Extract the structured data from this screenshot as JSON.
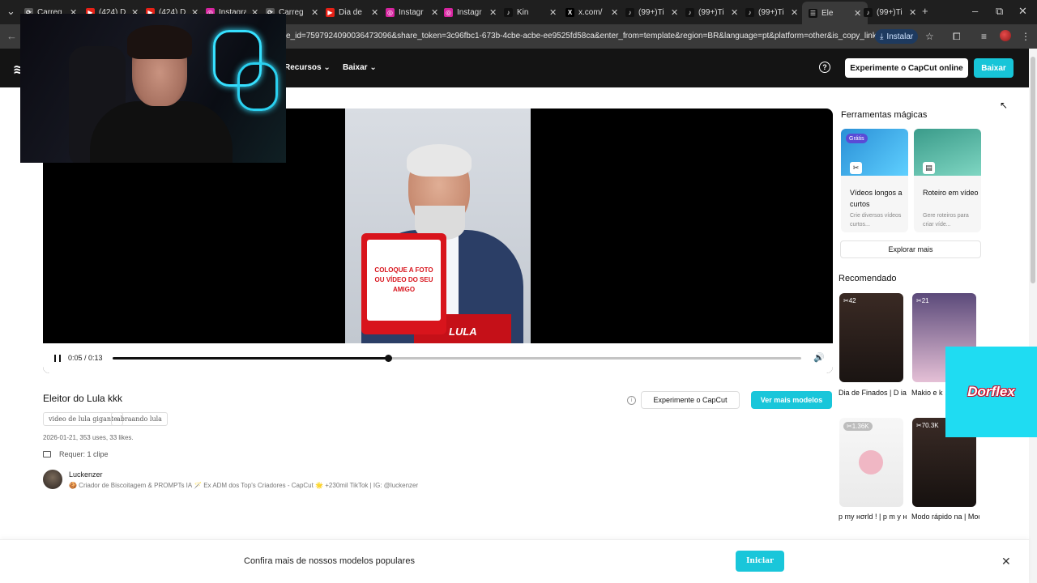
{
  "browser": {
    "tabs": [
      {
        "title": "Carreg",
        "fav": "⟳",
        "color": "#555"
      },
      {
        "title": "(424) D",
        "fav": "▶",
        "color": "#e62117"
      },
      {
        "title": "(424) D",
        "fav": "▶",
        "color": "#e62117"
      },
      {
        "title": "Instagra",
        "fav": "◎",
        "color": "#d6249f"
      },
      {
        "title": "Carreg",
        "fav": "⟳",
        "color": "#555"
      },
      {
        "title": "Dia de",
        "fav": "▶",
        "color": "#e62117"
      },
      {
        "title": "Instagr",
        "fav": "◎",
        "color": "#d6249f"
      },
      {
        "title": "Instagr",
        "fav": "◎",
        "color": "#d6249f"
      },
      {
        "title": "Kin",
        "fav": "♪",
        "color": "#111"
      },
      {
        "title": "x.com/",
        "fav": "X",
        "color": "#000"
      },
      {
        "title": "(99+)Ti",
        "fav": "♪",
        "color": "#111"
      },
      {
        "title": "(99+)Ti",
        "fav": "♪",
        "color": "#111"
      },
      {
        "title": "(99+)Ti",
        "fav": "♪",
        "color": "#111"
      },
      {
        "title": "Ele",
        "fav": "☰",
        "color": "#111"
      },
      {
        "title": "(99+)Ti",
        "fav": "♪",
        "color": "#111"
      }
    ],
    "url": "e_id=7597924090036473096&share_token=3c96fbc1-673b-4cbe-acbe-ee9525fd58ca&enter_from=template&region=BR&language=pt&platform=other&is_copy_link=0",
    "install_label": "Instalar"
  },
  "header": {
    "logo": "≋",
    "menu": [
      "Recursos",
      "Baixar"
    ],
    "try_online": "Experimente o CapCut online",
    "download": "Baixar"
  },
  "player": {
    "poster_text": "COLOQUE A FOTO OU VÍDEO DO SEU AMIGO",
    "poster_brand": "LULA",
    "time": "0:05 / 0:13",
    "progress": 0.4
  },
  "video": {
    "title": "Eleitor do Lula kkk",
    "tags": [
      "video de lula gigante",
      "abraando lula"
    ],
    "stats": "2026-01-21, 353 uses, 33 likes.",
    "requirement": "Requer: 1 clipe",
    "creator": "Luckenzer",
    "creator_bio": "🍪 Criador de Biscoitagem & PROMPTs IA 🪄 Ex ADM dos Top's Criadores - CapCut 🌟 +230mil TikTok | IG: @luckenzer",
    "try_button": "Experimente o CapCut",
    "more_models": "Ver mais modelos"
  },
  "sidebar": {
    "tools_heading": "Ferramentas mágicas",
    "tools": [
      {
        "title": "Vídeos longos a curtos",
        "desc": "Crie diversos vídeos curtos...",
        "badge": "Grátis"
      },
      {
        "title": "Roteiro em vídeo",
        "desc": "Gere roteiros para criar víde..."
      }
    ],
    "explore": "Explorar mais",
    "rec_heading": "Recomendado",
    "recommended": [
      {
        "uses": "42",
        "title": "Dia de Finados | D ia de Finados |#..."
      },
      {
        "uses": "21",
        "title": "Makio e k ✨ | Maki"
      },
      {
        "uses": "1.36K",
        "title": "p my нσrld ! | p m y нσrld ! |🫶"
      },
      {
        "uses": "70.3K",
        "title": "Modo rápido na | Modo rápido na |..."
      }
    ]
  },
  "ad": {
    "brand": "Dorflex"
  },
  "banner": {
    "text": "Confira mais de nossos modelos populares",
    "button": "Iniciar"
  },
  "colors": {
    "accent": "#19c6da",
    "header_bg": "#141414"
  }
}
